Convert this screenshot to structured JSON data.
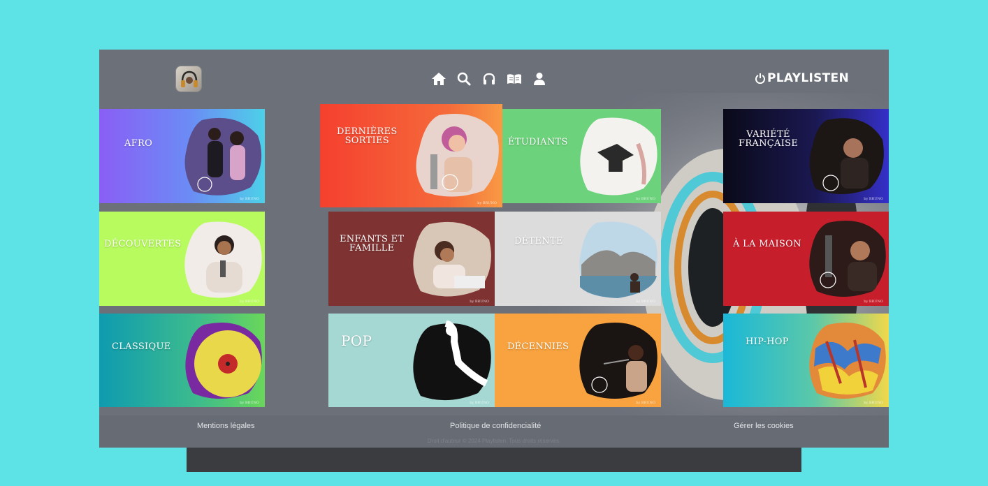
{
  "header": {
    "brand": "PLAYLISTEN",
    "nav": [
      {
        "icon": "home-icon"
      },
      {
        "icon": "search-icon"
      },
      {
        "icon": "headphones-icon"
      },
      {
        "icon": "book-icon"
      },
      {
        "icon": "user-icon"
      }
    ]
  },
  "tiles": {
    "afro": {
      "label": "AFRO",
      "by": "by BRUNO"
    },
    "dernieres_sorties": {
      "label": "DERNIÈRES\nSORTIES",
      "by": "by BRUNO"
    },
    "etudiants": {
      "label": "ÉTUDIANTS",
      "by": "by BRUNO"
    },
    "variete_francaise": {
      "label": "VARIÉTÉ\nFRANÇAISE",
      "by": "by BRUNO"
    },
    "decouvertes": {
      "label": "DÉCOUVERTES",
      "by": "by BRUNO"
    },
    "enfants_et_famille": {
      "label": "ENFANTS ET\nFAMILLE",
      "by": "by BRUNO"
    },
    "detente": {
      "label": "DÉTENTE",
      "by": "by BRUNO"
    },
    "a_la_maison": {
      "label": "À LA MAISON",
      "by": "by BRUNO"
    },
    "classique": {
      "label": "CLASSIQUE",
      "by": "by BRUNO"
    },
    "pop": {
      "label": "POP",
      "by": "by BRUNO"
    },
    "decennies": {
      "label": "DÉCENNIES",
      "by": "by BRUNO"
    },
    "hip_hop": {
      "label": "HIP-HOP",
      "by": "by BRUNO"
    }
  },
  "footer": {
    "legal": "Mentions légales",
    "privacy": "Politique de confidencialité",
    "cookies": "Gérer les cookies",
    "copyright": "Droit d'auteur © 2024 Playlisten. Tous droits réservés."
  },
  "colors": {
    "page_bg": "#5de2e6",
    "app_bg": "#6c7079",
    "footer_bg": "#676b73"
  }
}
